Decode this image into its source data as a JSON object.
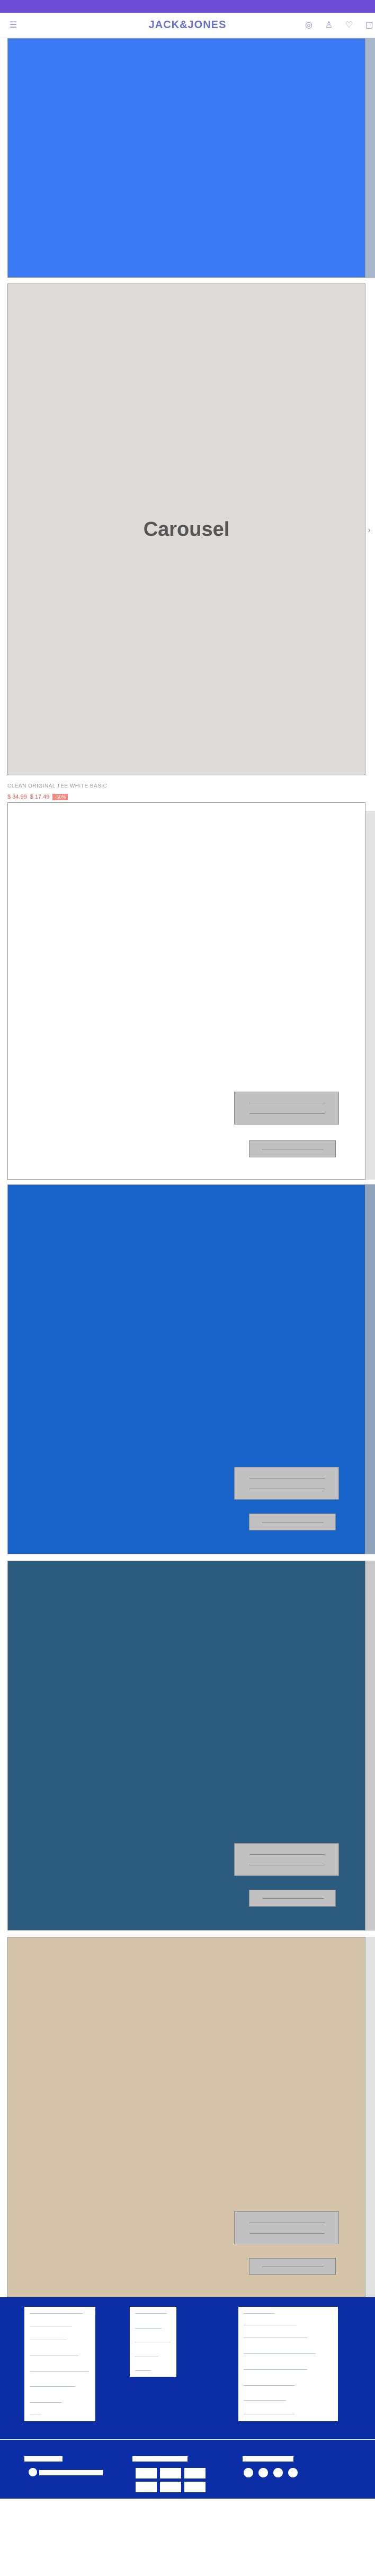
{
  "brand": {
    "logo": "JACK&JONES"
  },
  "header": {
    "icons": [
      "menu-icon",
      "location-icon",
      "account-icon",
      "wishlist-icon",
      "bag-icon"
    ]
  },
  "carousel": {
    "label": "Carousel"
  },
  "product": {
    "name": "CLEAN ORIGINAL TEE WHITE BASIC",
    "price_original": "$ 34.99",
    "price_sale": "$ 17.49",
    "badge": "-50%"
  },
  "colors": {
    "topbar": "#6a4fd6",
    "hero_blue": "#3b7af5",
    "carousel_bg": "#dedbd9",
    "panel_blue": "#1763c9",
    "panel_teal": "#2c5b80",
    "panel_beige": "#d6c4aa",
    "footer": "#0b2ea6",
    "sale_red": "#e8564b"
  }
}
